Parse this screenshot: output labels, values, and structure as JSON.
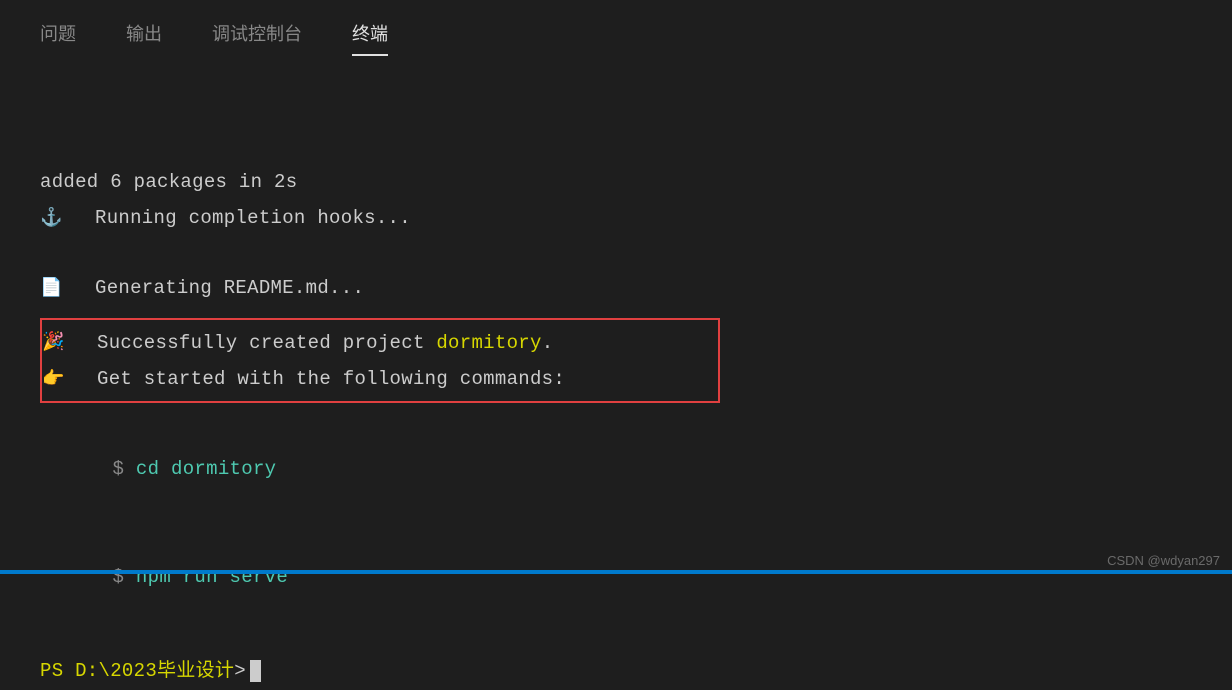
{
  "tabs": {
    "problems": "问题",
    "output": "输出",
    "debugConsole": "调试控制台",
    "terminal": "终端"
  },
  "terminal": {
    "addedPackages": "added 6 packages in 2s",
    "anchorIcon": "⚓",
    "runningHooks": "Running completion hooks...",
    "docIcon": "📄",
    "generatingReadme": "Generating README.md...",
    "partyIcon": "🎉",
    "successPrefix": "Successfully created project ",
    "projectName": "dormitory",
    "successSuffix": ".",
    "pointIcon": "👉",
    "getStarted": "Get started with the following commands:",
    "dollar": " $ ",
    "cmd1": "cd dormitory",
    "cmd2": "npm run serve",
    "promptPath": "PS D:\\2023毕业设计",
    "promptGt": "> "
  },
  "watermark": "CSDN @wdyan297"
}
